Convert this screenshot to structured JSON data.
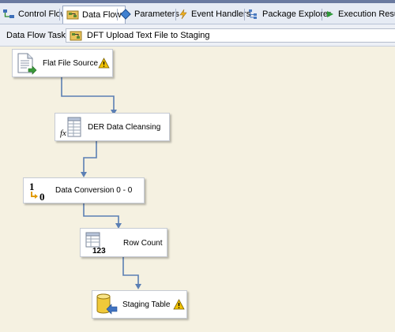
{
  "tabs": [
    {
      "label": "Control Flow",
      "icon": "control-flow-icon",
      "active": false
    },
    {
      "label": "Data Flow",
      "icon": "data-flow-icon",
      "active": true
    },
    {
      "label": "Parameters",
      "icon": "parameters-icon",
      "active": false
    },
    {
      "label": "Event Handlers",
      "icon": "event-handlers-icon",
      "active": false
    },
    {
      "label": "Package Explorer",
      "icon": "package-explorer-icon",
      "active": false
    },
    {
      "label": "Execution Results",
      "icon": "execution-results-icon",
      "active": false
    }
  ],
  "data_flow_task": {
    "label": "Data Flow Task:",
    "selected": "DFT Upload Text File to Staging"
  },
  "components": [
    {
      "name": "Flat File Source",
      "icon": "flat-file-source-icon",
      "warning": true
    },
    {
      "name": "DER Data Cleansing",
      "icon": "derived-column-icon",
      "warning": false
    },
    {
      "name": "Data Conversion 0 - 0",
      "icon": "data-conversion-icon",
      "warning": false
    },
    {
      "name": "Row Count",
      "icon": "row-count-icon",
      "warning": false
    },
    {
      "name": "Staging Table",
      "icon": "ole-db-destination-icon",
      "warning": true
    }
  ],
  "colors": {
    "canvas": "#f5f1e1",
    "connector": "#5b7fb4",
    "warning": "#f2c200"
  },
  "icon_glyphs": {
    "derived_fx": "fx",
    "conversion_one": "1",
    "conversion_zero": "0",
    "row_count_digits": "123"
  }
}
